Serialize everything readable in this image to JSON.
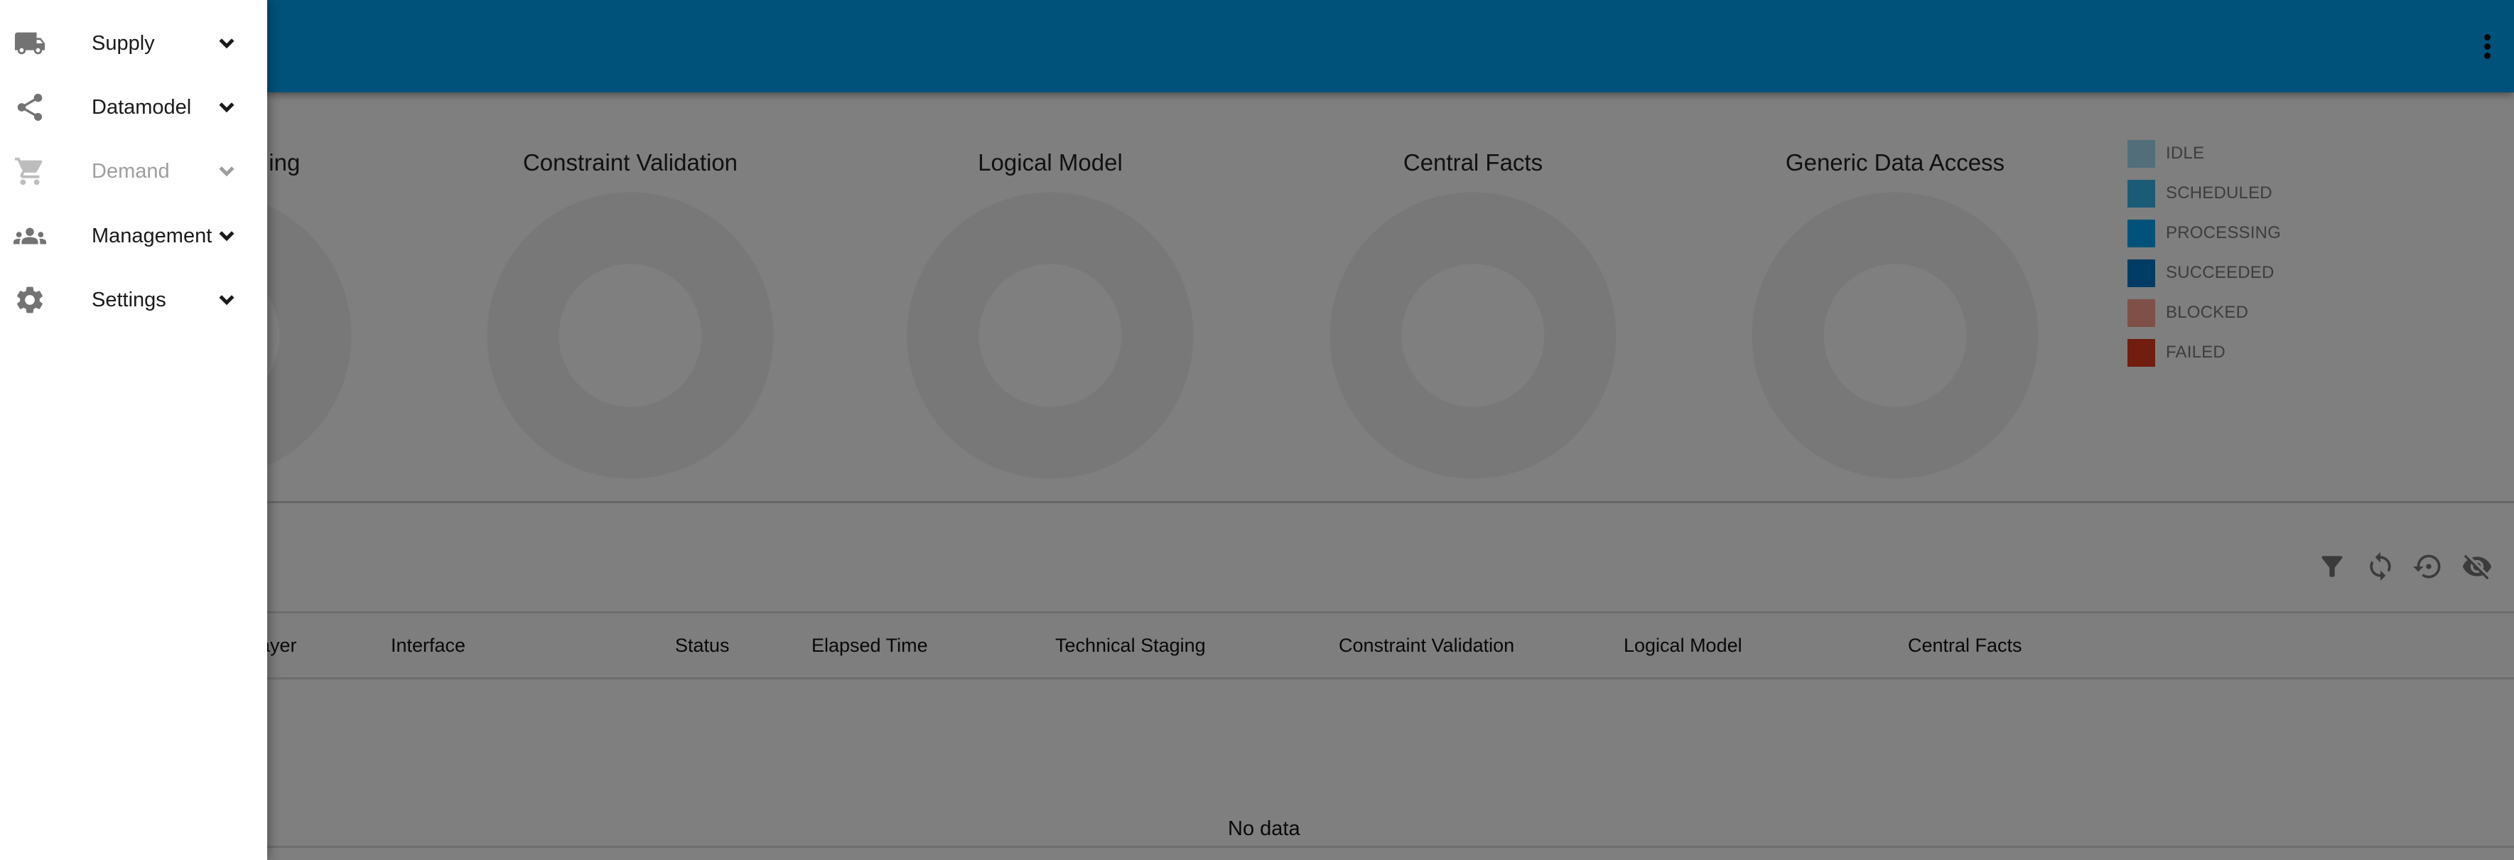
{
  "colors": {
    "header": "#00A4F4",
    "donut_empty": "#f0f0f0",
    "overlay": "rgba(0,0,0,0.5)"
  },
  "topbar": {
    "more_icon": "more-vert-icon"
  },
  "sidebar": {
    "items": [
      {
        "label": "Supply",
        "icon": "truck-icon",
        "disabled": false
      },
      {
        "label": "Datamodel",
        "icon": "share-icon",
        "disabled": false
      },
      {
        "label": "Demand",
        "icon": "cart-icon",
        "disabled": true
      },
      {
        "label": "Management",
        "icon": "groups-icon",
        "disabled": false
      },
      {
        "label": "Settings",
        "icon": "gear-icon",
        "disabled": false
      }
    ]
  },
  "chart_data": [
    {
      "type": "pie",
      "title": "Technical Staging",
      "categories": [
        "IDLE",
        "SCHEDULED",
        "PROCESSING",
        "SUCCEEDED",
        "BLOCKED",
        "FAILED"
      ],
      "values": [],
      "donut": true,
      "empty": true,
      "legend": "right"
    },
    {
      "type": "pie",
      "title": "Constraint Validation",
      "categories": [
        "IDLE",
        "SCHEDULED",
        "PROCESSING",
        "SUCCEEDED",
        "BLOCKED",
        "FAILED"
      ],
      "values": [],
      "donut": true,
      "empty": true,
      "legend": "right"
    },
    {
      "type": "pie",
      "title": "Logical Model",
      "categories": [
        "IDLE",
        "SCHEDULED",
        "PROCESSING",
        "SUCCEEDED",
        "BLOCKED",
        "FAILED"
      ],
      "values": [],
      "donut": true,
      "empty": true,
      "legend": "right"
    },
    {
      "type": "pie",
      "title": "Central Facts",
      "categories": [
        "IDLE",
        "SCHEDULED",
        "PROCESSING",
        "SUCCEEDED",
        "BLOCKED",
        "FAILED"
      ],
      "values": [],
      "donut": true,
      "empty": true,
      "legend": "right"
    },
    {
      "type": "pie",
      "title": "Generic Data Access",
      "categories": [
        "IDLE",
        "SCHEDULED",
        "PROCESSING",
        "SUCCEEDED",
        "BLOCKED",
        "FAILED"
      ],
      "values": [],
      "donut": true,
      "empty": true,
      "legend": "right"
    }
  ],
  "legend": [
    {
      "label": "IDLE",
      "color": "#A6DCF6"
    },
    {
      "label": "SCHEDULED",
      "color": "#36B6EC"
    },
    {
      "label": "PROCESSING",
      "color": "#00A4F4"
    },
    {
      "label": "SUCCEEDED",
      "color": "#0078C8"
    },
    {
      "label": "BLOCKED",
      "color": "#FFA090"
    },
    {
      "label": "FAILED",
      "color": "#E23A1E"
    }
  ],
  "toolbar": {
    "buttons": [
      {
        "icon": "filter-icon"
      },
      {
        "icon": "refresh-icon"
      },
      {
        "icon": "restore-icon"
      },
      {
        "icon": "visibility-off-icon"
      }
    ]
  },
  "table": {
    "columns": [
      "Layer",
      "Interface",
      "Status",
      "Elapsed Time",
      "Technical Staging",
      "Constraint Validation",
      "Logical Model",
      "Central Facts"
    ],
    "rows": [],
    "empty_text": "No data"
  }
}
